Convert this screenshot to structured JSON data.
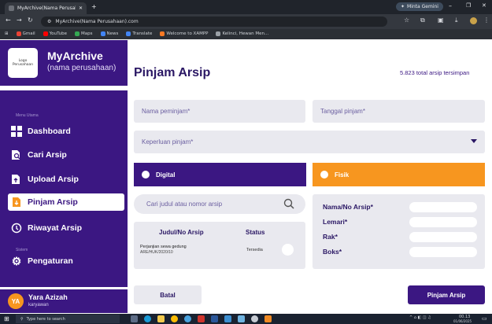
{
  "browser": {
    "tab_title": "MyArchive(Nama Perusahaan)",
    "tab_close": "✕",
    "new_tab": "+",
    "profile_chip": "Minta Gemini",
    "url": "MyArchive(Nama Perusahaan).com",
    "bookmarks": [
      "Gmail",
      "YouTube",
      "Maps",
      "News",
      "Translate",
      "Welcome to XAMPP",
      "Kelinci, Hewan Men..."
    ]
  },
  "brand": {
    "logo_text_1": "Logo",
    "logo_text_2": "Perusahaan",
    "title": "MyArchive",
    "subtitle": "(nama perusahaan)"
  },
  "sidebar": {
    "section_main": "Menu Utama",
    "items": [
      {
        "label": "Dashboard"
      },
      {
        "label": "Cari Arsip"
      },
      {
        "label": "Upload Arsip"
      },
      {
        "label": "Pinjam Arsip"
      },
      {
        "label": "Riwayat Arsip"
      }
    ],
    "section_system": "Sistem",
    "settings_label": "Pengaturan"
  },
  "user": {
    "initials": "YA",
    "name": "Yara Azizah",
    "role": "karyawan"
  },
  "header": {
    "title": "Pinjam Arsip",
    "total": "5.823 total arsip tersimpan"
  },
  "form": {
    "borrower_placeholder": "Nama peminjam*",
    "date_placeholder": "Tanggal pinjam*",
    "purpose_placeholder": "Keperluan pinjam*",
    "type_digital": "Digital",
    "type_physical": "Fisik",
    "search_placeholder": "Cari judul atau nomor arsip",
    "table": {
      "col_title": "Judul/No Arsip",
      "col_status": "Status",
      "rows": [
        {
          "title": "Perjanjian sewa gedung",
          "number": "ARE/HUK/2020/10",
          "status": "Tersedia"
        }
      ]
    },
    "physical": {
      "number_label": "Nama/No Arsip*",
      "cabinet_label": "Lemari*",
      "rack_label": "Rak*",
      "box_label": "Boks*"
    },
    "cancel_label": "Batal",
    "submit_label": "Pinjam Arsip"
  },
  "taskbar": {
    "search_placeholder": "Type here to search",
    "time": "00.13",
    "date": "01/06/2025"
  },
  "colors": {
    "primary": "#3b1782",
    "accent": "#f7961f",
    "field": "#e9e9ef"
  }
}
